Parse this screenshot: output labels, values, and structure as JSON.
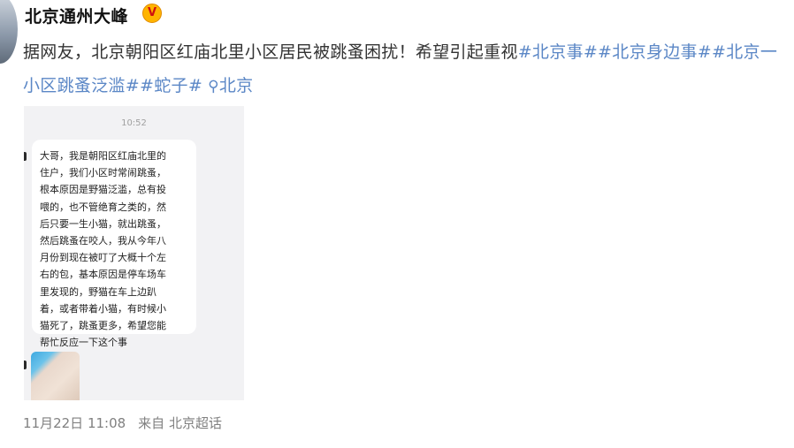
{
  "header": {
    "username": "北京通州大峰",
    "verified_badge": "V"
  },
  "post": {
    "text": "据网友，北京朝阳区红庙北里小区居民被跳蚤困扰！希望引起重视",
    "hashtags": [
      "#北京事#",
      "#北京身边事#",
      "#北京一小区跳蚤泛滥#",
      "#蛇子#"
    ],
    "location_icon": "location-pin-icon",
    "location": "北京"
  },
  "screenshot": {
    "time": "10:52",
    "message": "大哥，我是朝阳区红庙北里的\n住户，我们小区时常闹跳蚤，\n根本原因是野猫泛滥，总有投\n喂的，也不管绝育之类的，然\n后只要一生小猫，就出跳蚤，\n然后跳蚤在咬人，我从今年八\n月份到现在被叮了大概十个左\n右的包，基本原因是停车场车\n里发现的，野猫在车上边趴\n着，或者带着小猫，有时候小\n猫死了，跳蚤更多，希望您能\n帮忙反应一下这个事"
  },
  "footer": {
    "date": "11月22日 11:08",
    "source": "来自 北京超话"
  },
  "colors": {
    "link": "#5b87c6",
    "badge": "#ffb400"
  }
}
